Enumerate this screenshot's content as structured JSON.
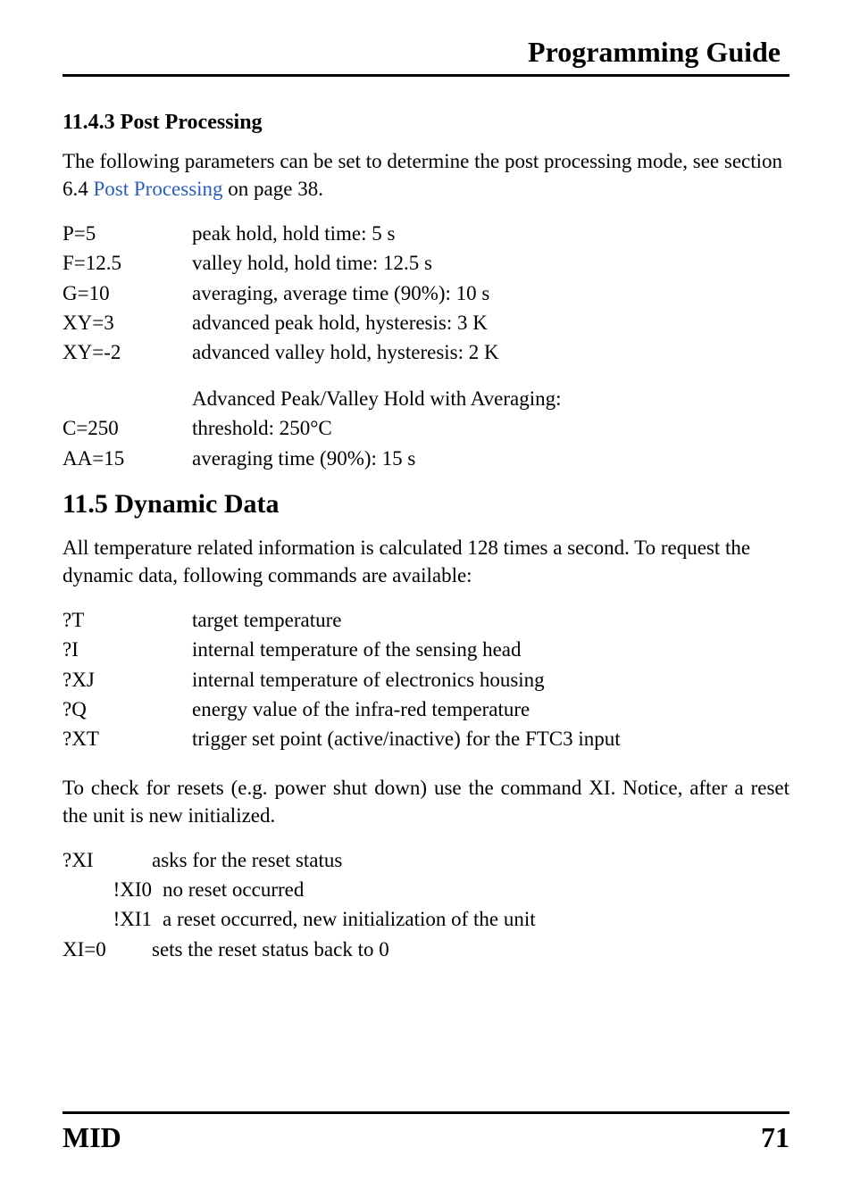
{
  "header_title": "Programming Guide",
  "section_1143": {
    "heading": "11.4.3 Post Processing",
    "intro_pre": "The following parameters can be set to determine the post processing mode, see section 6.4 ",
    "intro_link": "Post Processing",
    "intro_post": " on page 38.",
    "params": [
      {
        "k": "P=5",
        "v": "peak hold, hold time: 5 s"
      },
      {
        "k": "F=12.5",
        "v": "valley hold, hold time: 12.5 s"
      },
      {
        "k": "G=10",
        "v": "averaging, average time (90%): 10 s"
      },
      {
        "k": "XY=3",
        "v": "advanced peak hold, hysteresis: 3 K"
      },
      {
        "k": "XY=-2",
        "v": "advanced valley hold, hysteresis: 2 K"
      }
    ],
    "group_heading": "Advanced Peak/Valley Hold with Averaging:",
    "group_params": [
      {
        "k": "C=250",
        "v": "threshold: 250°C"
      },
      {
        "k": "AA=15",
        "v": "averaging time (90%): 15 s"
      }
    ]
  },
  "section_115": {
    "heading": "11.5 Dynamic Data",
    "intro": "All temperature related information is calculated 128 times a second. To request the dynamic data, following commands are available:",
    "commands": [
      {
        "k": "?T",
        "v": "target temperature"
      },
      {
        "k": "?I",
        "v": "internal temperature of the sensing head"
      },
      {
        "k": "?XJ",
        "v": "internal temperature of electronics housing"
      },
      {
        "k": "?Q",
        "v": "energy value of the infra-red temperature"
      },
      {
        "k": "?XT",
        "v": "trigger set point (active/inactive) for the FTC3 input"
      }
    ],
    "reset_intro": "To check for resets (e.g. power shut down) use the command XI. Notice, after a reset the unit is new initialized.",
    "reset_rows": [
      {
        "k": "?XI",
        "v": "asks for the reset status",
        "sub": false
      },
      {
        "k": "!XI0",
        "v": "no reset occurred",
        "sub": true
      },
      {
        "k": "!XI1",
        "v": "a reset occurred, new initialization of the unit",
        "sub": true
      },
      {
        "k": "XI=0",
        "v": "sets the reset status back to 0",
        "sub": false
      }
    ]
  },
  "footer": {
    "left": "MID",
    "right": "71"
  }
}
